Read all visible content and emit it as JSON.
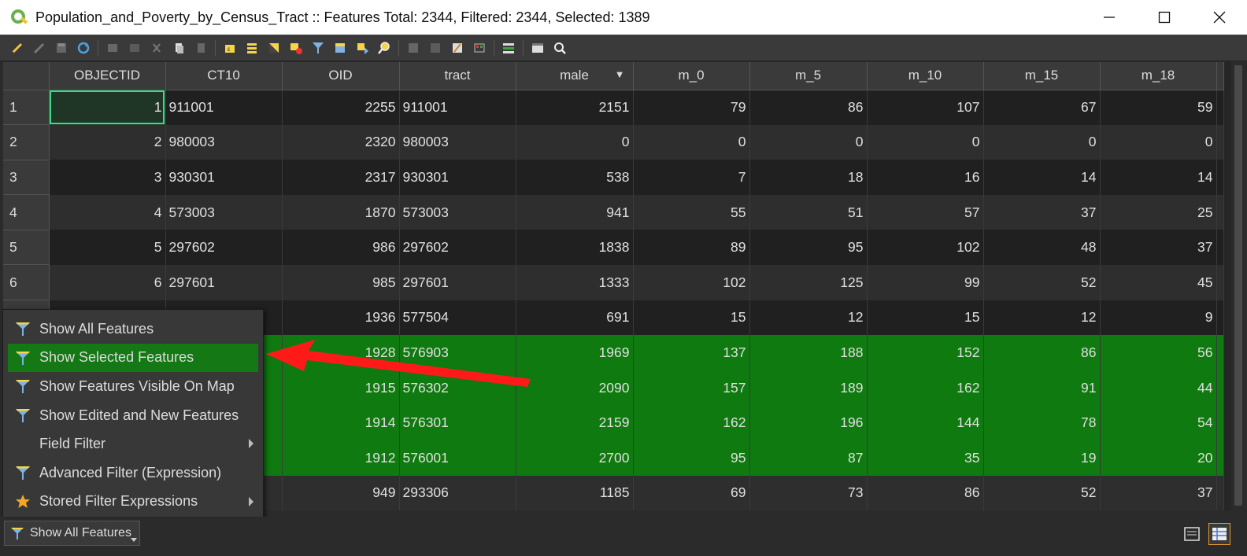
{
  "window": {
    "title": "Population_and_Poverty_by_Census_Tract :: Features Total: 2344, Filtered: 2344, Selected: 1389"
  },
  "table": {
    "columns": [
      "OBJECTID",
      "CT10",
      "OID",
      "tract",
      "male",
      "m_0",
      "m_5",
      "m_10",
      "m_15",
      "m_18"
    ],
    "sorted_column": "male",
    "sort_indicator": "▼",
    "rows": [
      {
        "rownum": "1",
        "cells": [
          "1",
          "911001",
          "2255",
          "911001",
          "2151",
          "79",
          "86",
          "107",
          "67",
          "59"
        ],
        "selected": false
      },
      {
        "rownum": "2",
        "cells": [
          "2",
          "980003",
          "2320",
          "980003",
          "0",
          "0",
          "0",
          "0",
          "0",
          "0"
        ],
        "selected": false
      },
      {
        "rownum": "3",
        "cells": [
          "3",
          "930301",
          "2317",
          "930301",
          "538",
          "7",
          "18",
          "16",
          "14",
          "14"
        ],
        "selected": false
      },
      {
        "rownum": "4",
        "cells": [
          "4",
          "573003",
          "1870",
          "573003",
          "941",
          "55",
          "51",
          "57",
          "37",
          "25"
        ],
        "selected": false
      },
      {
        "rownum": "5",
        "cells": [
          "5",
          "297602",
          "986",
          "297602",
          "1838",
          "89",
          "95",
          "102",
          "48",
          "37"
        ],
        "selected": false
      },
      {
        "rownum": "6",
        "cells": [
          "6",
          "297601",
          "985",
          "297601",
          "1333",
          "102",
          "125",
          "99",
          "52",
          "45"
        ],
        "selected": false
      },
      {
        "rownum": "",
        "cells": [
          "",
          "",
          "1936",
          "577504",
          "691",
          "15",
          "12",
          "15",
          "12",
          "9"
        ],
        "selected": false
      },
      {
        "rownum": "",
        "cells": [
          "",
          "",
          "1928",
          "576903",
          "1969",
          "137",
          "188",
          "152",
          "86",
          "56"
        ],
        "selected": true
      },
      {
        "rownum": "",
        "cells": [
          "",
          "",
          "1915",
          "576302",
          "2090",
          "157",
          "189",
          "162",
          "91",
          "44"
        ],
        "selected": true
      },
      {
        "rownum": "",
        "cells": [
          "",
          "",
          "1914",
          "576301",
          "2159",
          "162",
          "196",
          "144",
          "78",
          "54"
        ],
        "selected": true
      },
      {
        "rownum": "",
        "cells": [
          "",
          "",
          "1912",
          "576001",
          "2700",
          "95",
          "87",
          "35",
          "19",
          "20"
        ],
        "selected": true
      },
      {
        "rownum": "",
        "cells": [
          "",
          "",
          "949",
          "293306",
          "1185",
          "69",
          "73",
          "86",
          "52",
          "37"
        ],
        "selected": false
      }
    ]
  },
  "menu": {
    "items": [
      {
        "label": "Show All Features",
        "icon": "filter-icon",
        "active": false,
        "submenu": false
      },
      {
        "label": "Show Selected Features",
        "icon": "filter-icon",
        "active": true,
        "submenu": false
      },
      {
        "label": "Show Features Visible On Map",
        "icon": "filter-icon",
        "active": false,
        "submenu": false
      },
      {
        "label": "Show Edited and New Features",
        "icon": "filter-icon",
        "active": false,
        "submenu": false
      },
      {
        "label": "Field Filter",
        "icon": "",
        "active": false,
        "submenu": true
      },
      {
        "label": "Advanced Filter (Expression)",
        "icon": "filter-icon",
        "active": false,
        "submenu": false
      },
      {
        "label": "Stored Filter Expressions",
        "icon": "star-icon",
        "active": false,
        "submenu": true
      }
    ]
  },
  "bottombar": {
    "filter_button_label": "Show All Features"
  },
  "colors": {
    "selected_row": "#0f7a0f",
    "menu_active": "#147814",
    "annotation_arrow": "#ff1a1a",
    "filter_icon_yellow": "#f5d547",
    "filter_icon_blue": "#7fb2e5"
  }
}
